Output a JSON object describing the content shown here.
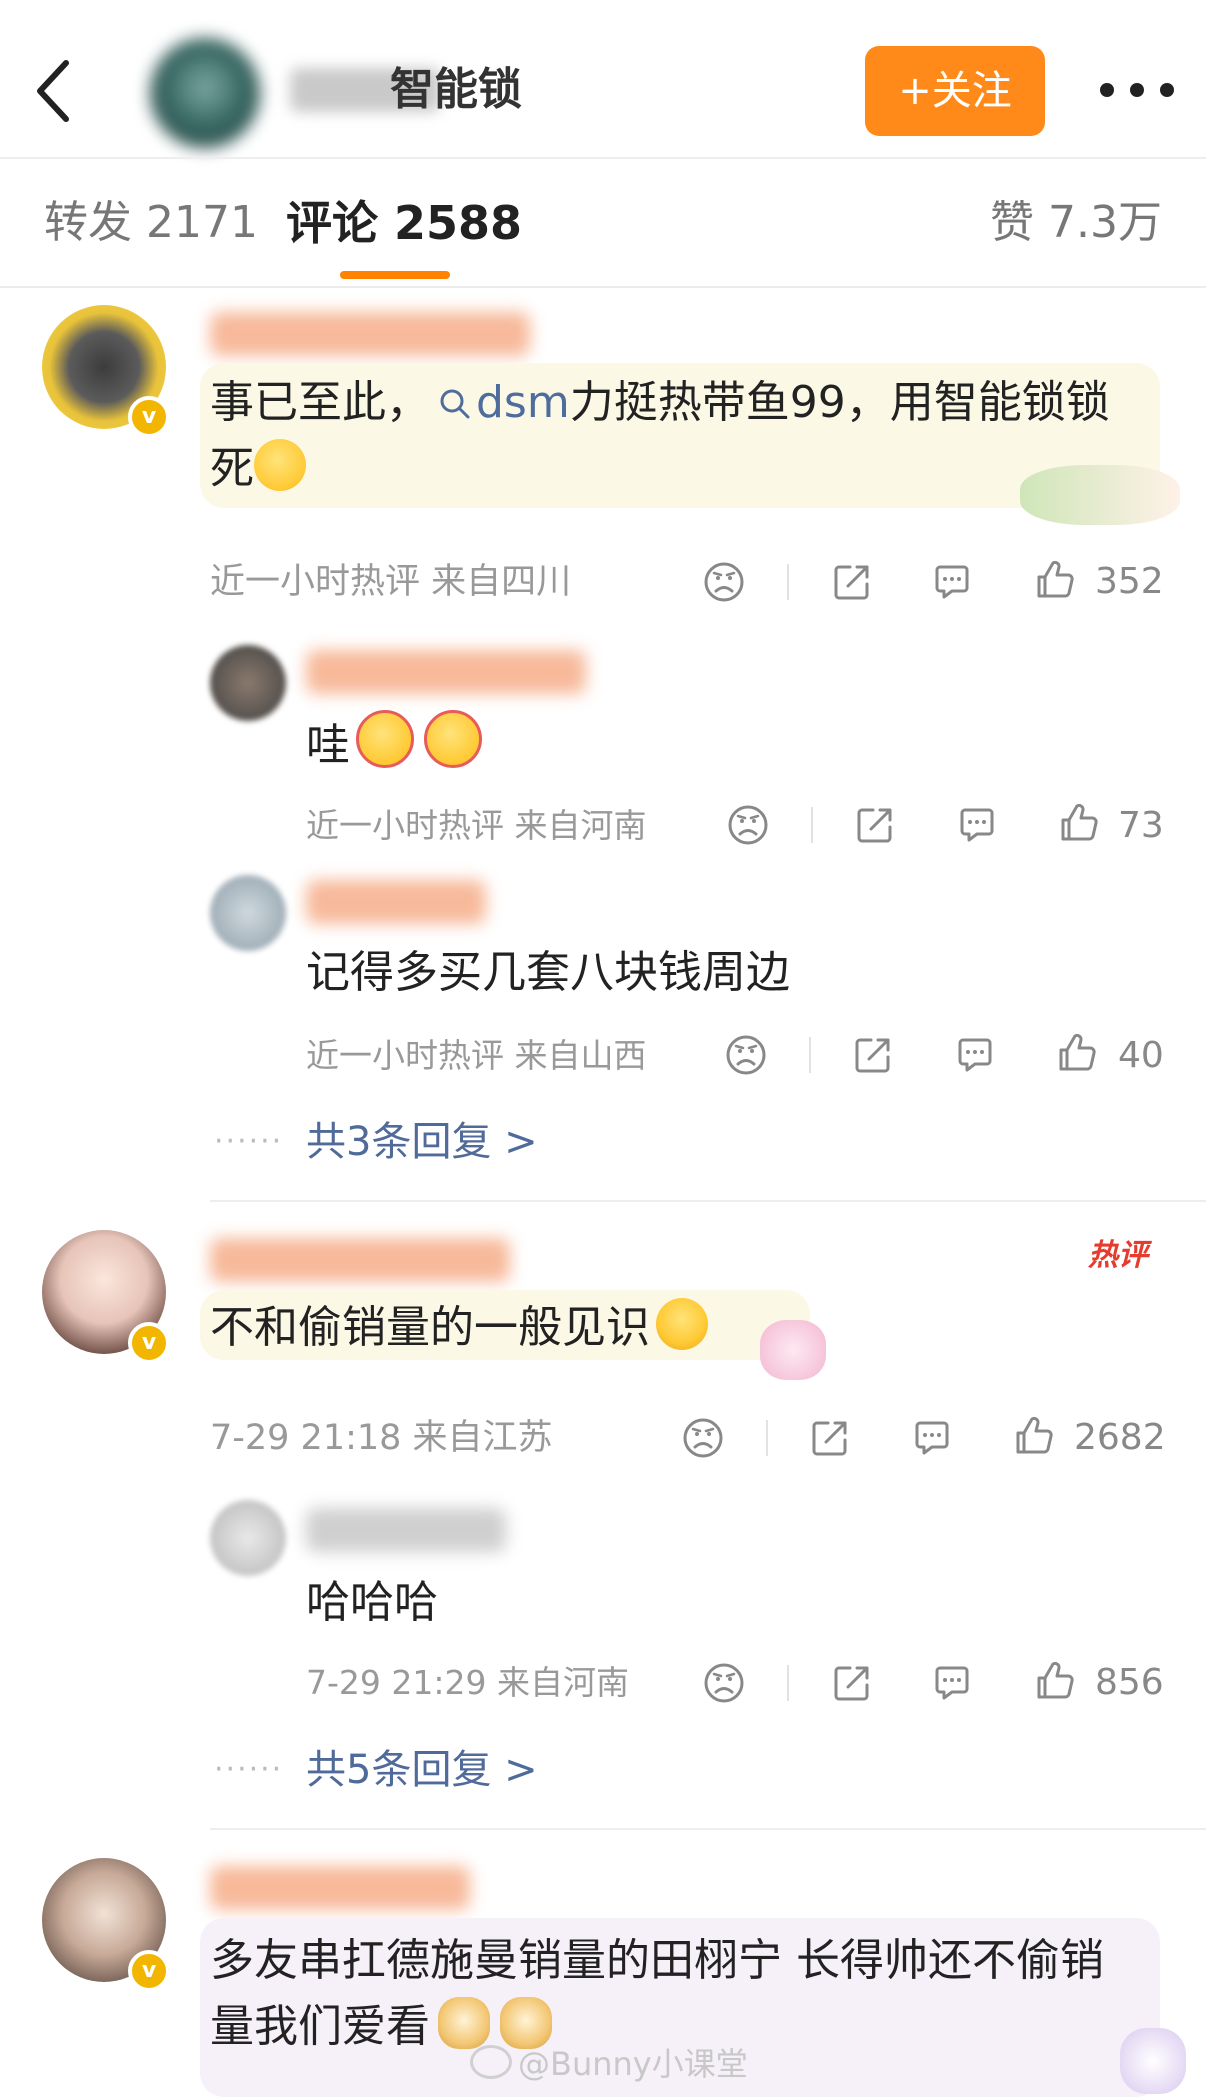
{
  "header": {
    "title": "智能锁",
    "follow_label": "+关注"
  },
  "tabs": {
    "forward": "转发 2171",
    "comments": "评论 2588",
    "likes": "赞 7.3万"
  },
  "comments": [
    {
      "text_a": "事已至此，",
      "topic": "dsm",
      "text_b": "力挺热带鱼99，用智能锁锁",
      "text_c": "死",
      "meta": "近一小时热评  来自四川",
      "likes": "352",
      "replies": [
        {
          "text": "哇",
          "meta": "近一小时热评  来自河南",
          "likes": "73"
        },
        {
          "text": "记得多买几套八块钱周边",
          "meta": "近一小时热评  来自山西",
          "likes": "40"
        }
      ],
      "more_replies": "共3条回复 >"
    },
    {
      "hot_tag": "热评",
      "text": "不和偷销量的一般见识",
      "meta": "7-29 21:18  来自江苏",
      "likes": "2682",
      "replies": [
        {
          "text": "哈哈哈",
          "meta": "7-29 21:29  来自河南",
          "likes": "856"
        }
      ],
      "more_replies": "共5条回复 >"
    },
    {
      "text_a": "多友串扛德施曼销量的田栩宁 长得帅还不偷销",
      "text_b": "量我们爱看"
    }
  ],
  "watermark": "@Bunny小课堂",
  "icons": {
    "back": "chevron-left-icon",
    "more": "more-dots-icon",
    "dislike": "sad-face-icon",
    "share": "share-icon",
    "reply": "comment-icon",
    "like": "thumbs-up-icon",
    "topic": "search-icon",
    "verified": "verified-badge-icon"
  },
  "colors": {
    "accent": "#ff8a1a",
    "tab_underline": "#ff8200",
    "link": "#506a99",
    "hot": "#e53c2e",
    "badge": "#f2b500"
  }
}
